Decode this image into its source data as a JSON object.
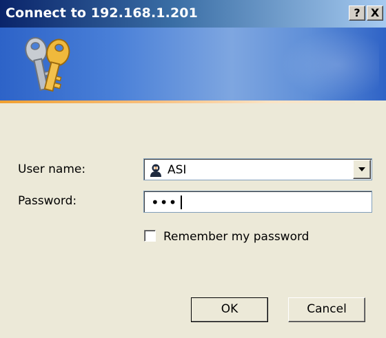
{
  "window": {
    "title": "Connect to 192.168.1.201",
    "help_label": "?",
    "close_label": "X"
  },
  "form": {
    "username_label": "User name:",
    "username_value": "ASI",
    "password_label": "Password:",
    "password_value": "•••",
    "remember_label": "Remember my password",
    "remember_checked": false
  },
  "buttons": {
    "ok_label": "OK",
    "cancel_label": "Cancel"
  },
  "icons": {
    "banner": "keys-icon",
    "user": "user-icon",
    "dropdown": "chevron-down-icon"
  },
  "colors": {
    "title_bar_start": "#0a246a",
    "banner": "#4a80d8",
    "dialog_bg": "#ece9d8",
    "accent_line": "#f0a030"
  }
}
